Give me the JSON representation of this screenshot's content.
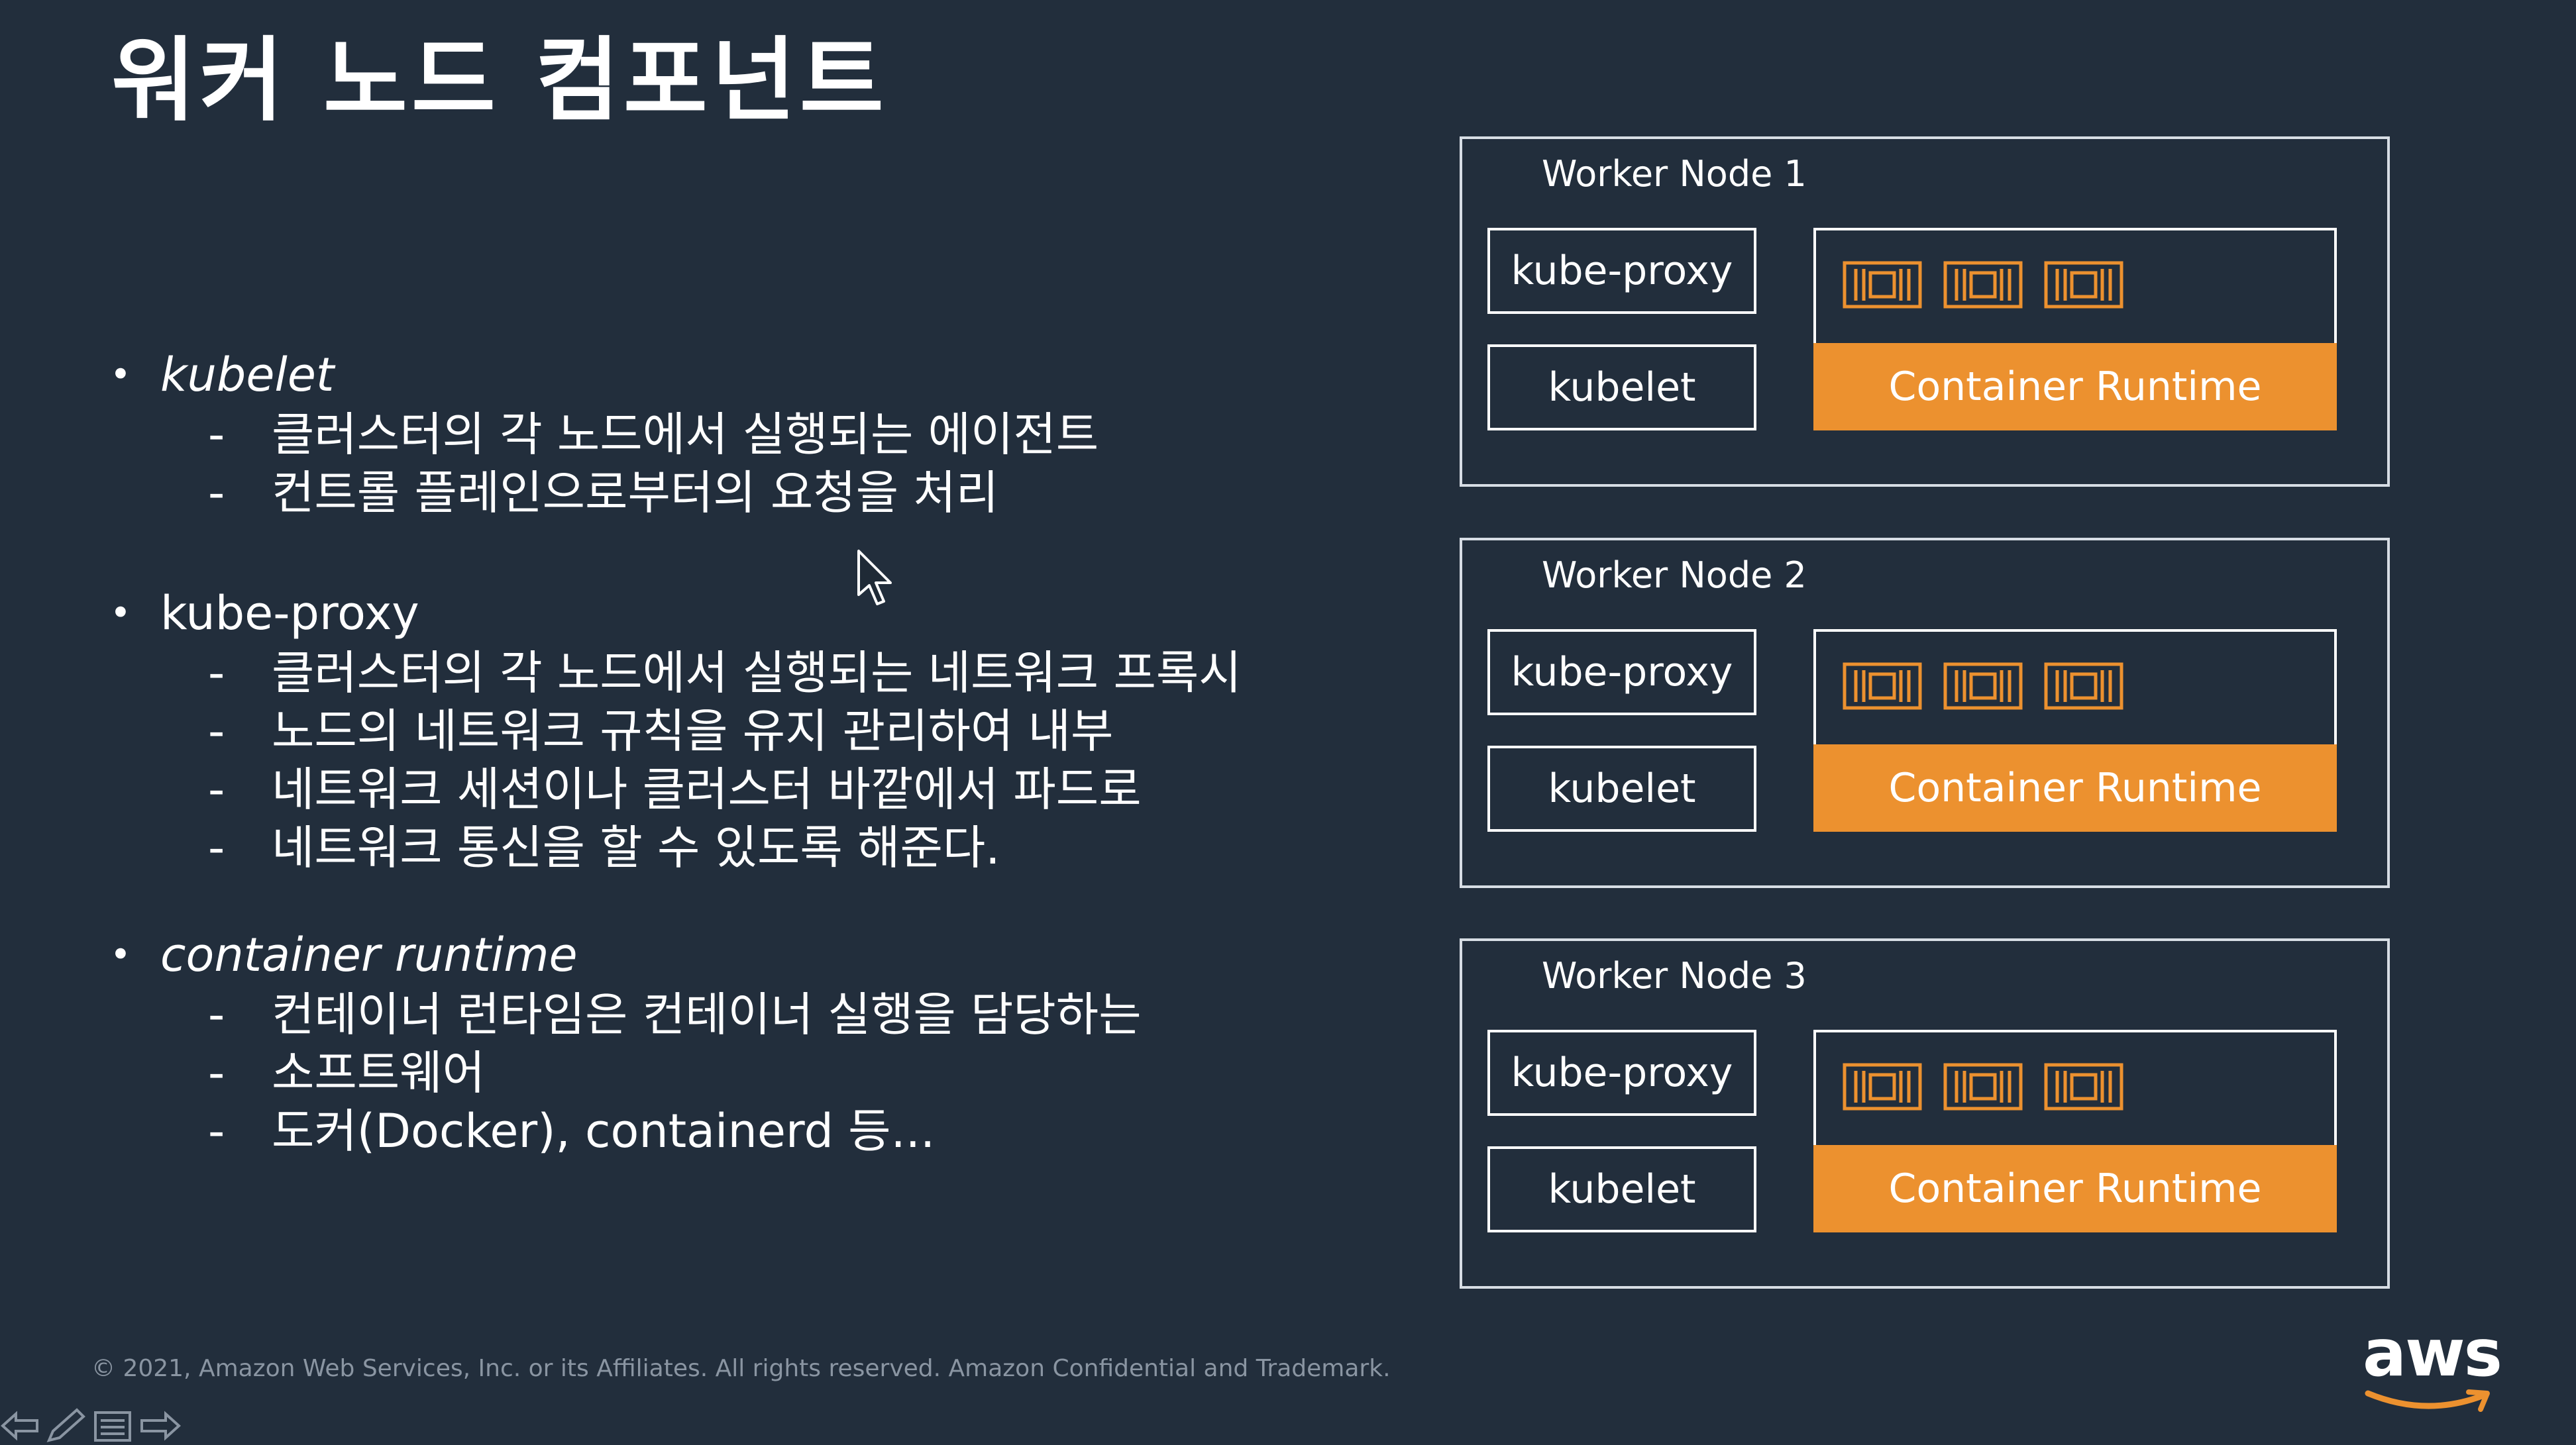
{
  "slide": {
    "title": "워커 노드 컴포넌트",
    "footer": "© 2021, Amazon Web Services, Inc. or its Affiliates. All rights reserved. Amazon Confidential and Trademark.",
    "logo_text": "aws"
  },
  "bullets": [
    {
      "head": "kubelet",
      "italic": true,
      "items": [
        "클러스터의 각 노드에서 실행되는 에이전트",
        "컨트롤 플레인으로부터의 요청을 처리"
      ]
    },
    {
      "head": "kube-proxy",
      "italic": false,
      "items": [
        "클러스터의 각 노드에서 실행되는 네트워크 프록시",
        "노드의 네트워크 규칙을 유지 관리하여 내부",
        "네트워크 세션이나 클러스터 바깥에서 파드로",
        "네트워크 통신을 할 수 있도록 해준다."
      ]
    },
    {
      "head": "container runtime",
      "italic": true,
      "items": [
        "컨테이너 런타임은 컨테이너 실행을 담당하는",
        "소프트웨어",
        "도커(Docker), containerd 등..."
      ]
    }
  ],
  "diagram": {
    "nodes": [
      {
        "label": "Worker Node 1",
        "proxy": "kube-proxy",
        "kubelet": "kubelet",
        "runtime": "Container Runtime"
      },
      {
        "label": "Worker Node 2",
        "proxy": "kube-proxy",
        "kubelet": "kubelet",
        "runtime": "Container Runtime"
      },
      {
        "label": "Worker Node 3",
        "proxy": "kube-proxy",
        "kubelet": "kubelet",
        "runtime": "Container Runtime"
      }
    ],
    "pod_icon": "container-chip-icon",
    "colors": {
      "background": "#222e3c",
      "accent": "#ec912f",
      "border": "#d7dde4"
    }
  },
  "icons": {
    "nav": [
      "back-arrow-icon",
      "pen-icon",
      "menu-icon",
      "forward-arrow-icon"
    ],
    "cursor": "mouse-pointer-icon"
  }
}
